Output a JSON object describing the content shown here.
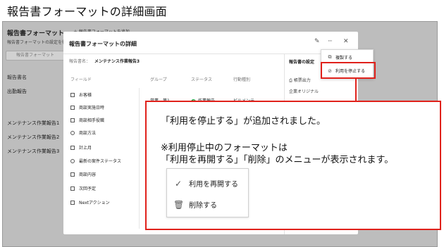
{
  "slide": {
    "title": "報告書フォーマットの詳細画面"
  },
  "app": {
    "title": "報告書フォーマット",
    "add_button": "＋ 報告書フォーマットを追加",
    "subtitle": "報告書フォーマットの設定を行",
    "search_placeholder": "報告書フォーマット",
    "column_header": "報告書名",
    "rows": [
      "出勤報告",
      "メンテナンス作業報告1",
      "メンテナンス作業報告2",
      "メンテナンス作業報告3"
    ]
  },
  "modal": {
    "title": "報告書フォーマットの詳細",
    "name_label": "報告書名：",
    "name_value": "メンテナンス作業報告3",
    "columns": [
      "フィールド",
      "グループ",
      "ステータス",
      "行動種別"
    ],
    "fields": [
      "お客様",
      "商談実施日時",
      "商談相手役職",
      "商談方法",
      "計上月",
      "最新の案件ステータス",
      "商談内容",
      "次回予定",
      "Nextアクション"
    ],
    "first_row": {
      "group": "営業 - 第1",
      "status": "作業報告",
      "action": "ビルメンテ"
    },
    "right_label": "報告書の設定",
    "right_items": [
      "帳票出力",
      "企業オリジナル"
    ],
    "icons": {
      "edit": "✎",
      "more": "···",
      "close": "✕"
    }
  },
  "dropdown": {
    "items": [
      {
        "label": "複製する",
        "icon": "copy-icon"
      },
      {
        "label": "利用を停止する",
        "icon": "ban-icon"
      }
    ]
  },
  "callout": {
    "line1": "「利用を停止する」が追加されました。",
    "line2": "※利用停止中のフォーマットは",
    "line3": "「利用を再開する」「削除」のメニューが表示されます。",
    "menu": [
      {
        "label": "利用を再開する",
        "icon": "check-icon"
      },
      {
        "label": "削除する",
        "icon": "trash-icon"
      }
    ]
  },
  "colors": {
    "highlight": "#e0211b",
    "overlay": "#bdbdbd",
    "status_ok": "#2e9a3e"
  }
}
